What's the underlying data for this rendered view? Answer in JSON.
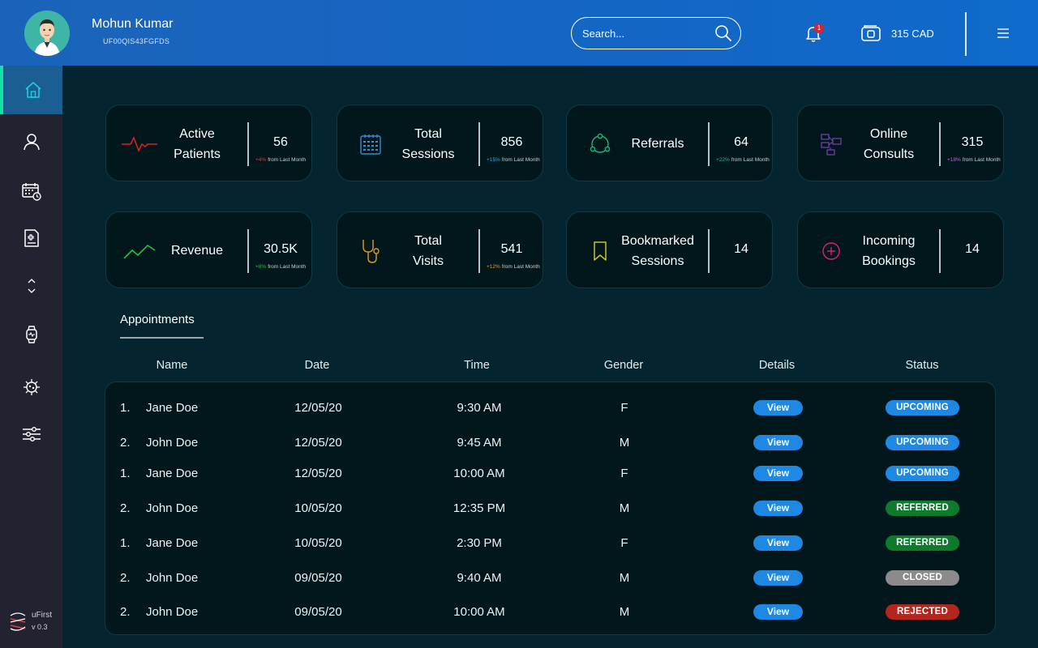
{
  "colors": {
    "header": "#1466c4",
    "sidebar": "#222231",
    "background": "#042530",
    "card": "#02171c",
    "active_nav_accent": "#16e0a6",
    "view_button": "#1e88e5",
    "status_upcoming": "#1e88e5",
    "status_referred": "#0d7a2c",
    "status_closed": "#8b8b8b",
    "status_rejected": "#b3261e"
  },
  "header": {
    "user_name": "Mohun Kumar",
    "user_id": "UF00QIS43FGFDS",
    "search_placeholder": "Search...",
    "notification_count": "1",
    "balance": "315 CAD",
    "icons": [
      "avatar",
      "search-icon",
      "bell-icon",
      "wallet-icon",
      "menu-icon"
    ]
  },
  "sidebar": {
    "items": [
      {
        "icon": "home-icon",
        "active": true
      },
      {
        "icon": "user-icon",
        "active": false
      },
      {
        "icon": "calendar-clock-icon",
        "active": false
      },
      {
        "icon": "medical-report-icon",
        "active": false
      },
      {
        "icon": "chevrons-icon",
        "active": false
      },
      {
        "icon": "smartwatch-icon",
        "active": false
      },
      {
        "icon": "virus-icon",
        "active": false
      },
      {
        "icon": "sliders-icon",
        "active": false
      }
    ],
    "brand": {
      "name": "uFirst",
      "version": "v 0.3"
    }
  },
  "stats": [
    {
      "label_1": "Active",
      "label_2": "Patients",
      "value": "56",
      "delta": "+4%",
      "delta_suffix": "from Last Month",
      "delta_color": "#e53935",
      "icon": "heartbeat-icon",
      "icon_color": "#e02020"
    },
    {
      "label_1": "Total",
      "label_2": "Sessions",
      "value": "856",
      "delta": "+15%",
      "delta_suffix": "from Last Month",
      "delta_color": "#3aa6d8",
      "icon": "calendar-grid-icon",
      "icon_color": "#2f8fcf"
    },
    {
      "label_1": "Referrals",
      "label_2": "",
      "value": "64",
      "delta": "+22%",
      "delta_suffix": "from Last Month",
      "delta_color": "#1fbf7a",
      "icon": "share-circle-icon",
      "icon_color": "#18b879"
    },
    {
      "label_1": "Online",
      "label_2": "Consults",
      "value": "315",
      "delta": "+18%",
      "delta_suffix": "from Last Month",
      "delta_color": "#b66bd8",
      "icon": "network-icon",
      "icon_color": "#6d3fa6"
    },
    {
      "label_1": "Revenue",
      "label_2": "",
      "value": "30.5K",
      "delta": "+8%",
      "delta_suffix": "from Last Month",
      "delta_color": "#1fbf3a",
      "icon": "trend-up-icon",
      "icon_color": "#1fc43a"
    },
    {
      "label_1": "Total",
      "label_2": "Visits",
      "value": "541",
      "delta": "+12%",
      "delta_suffix": "from Last Month",
      "delta_color": "#d8a23a",
      "icon": "stethoscope-icon",
      "icon_color": "#d8a020"
    },
    {
      "label_1": "Bookmarked",
      "label_2": "Sessions",
      "value": "14",
      "delta": "",
      "delta_suffix": "",
      "delta_color": "#c9c420",
      "icon": "bookmark-icon",
      "icon_color": "#c9c420"
    },
    {
      "label_1": "Incoming",
      "label_2": "Bookings",
      "value": "14",
      "delta": "",
      "delta_suffix": "",
      "delta_color": "#d8207a",
      "icon": "plus-circle-icon",
      "icon_color": "#d8207a"
    }
  ],
  "appointments": {
    "tab_title": "Appointments",
    "columns": {
      "name": "Name",
      "date": "Date",
      "time": "Time",
      "gender": "Gender",
      "details": "Details",
      "status": "Status"
    },
    "view_label": "View",
    "rows": [
      {
        "num": "1.",
        "name": "Jane Doe",
        "date": "12/05/20",
        "time": "9:30 AM",
        "gender": "F",
        "status": "UPCOMING",
        "status_color": "#1e88e5"
      },
      {
        "num": "2.",
        "name": "John Doe",
        "date": "12/05/20",
        "time": "9:45 AM",
        "gender": "M",
        "status": "UPCOMING",
        "status_color": "#1e88e5"
      },
      {
        "num": "1.",
        "name": "Jane Doe",
        "date": "12/05/20",
        "time": "10:00 AM",
        "gender": "F",
        "status": "UPCOMING",
        "status_color": "#1e88e5"
      },
      {
        "num": "2.",
        "name": "John Doe",
        "date": "10/05/20",
        "time": "12:35 PM",
        "gender": "M",
        "status": "REFERRED",
        "status_color": "#0d7a2c"
      },
      {
        "num": "1.",
        "name": "Jane Doe",
        "date": "10/05/20",
        "time": "2:30 PM",
        "gender": "F",
        "status": "REFERRED",
        "status_color": "#0d7a2c"
      },
      {
        "num": "2.",
        "name": "John Doe",
        "date": "09/05/20",
        "time": "9:40 AM",
        "gender": "M",
        "status": "CLOSED",
        "status_color": "#8b8b8b"
      },
      {
        "num": "2.",
        "name": "John Doe",
        "date": "09/05/20",
        "time": "10:00 AM",
        "gender": "M",
        "status": "REJECTED",
        "status_color": "#b3261e"
      }
    ]
  }
}
